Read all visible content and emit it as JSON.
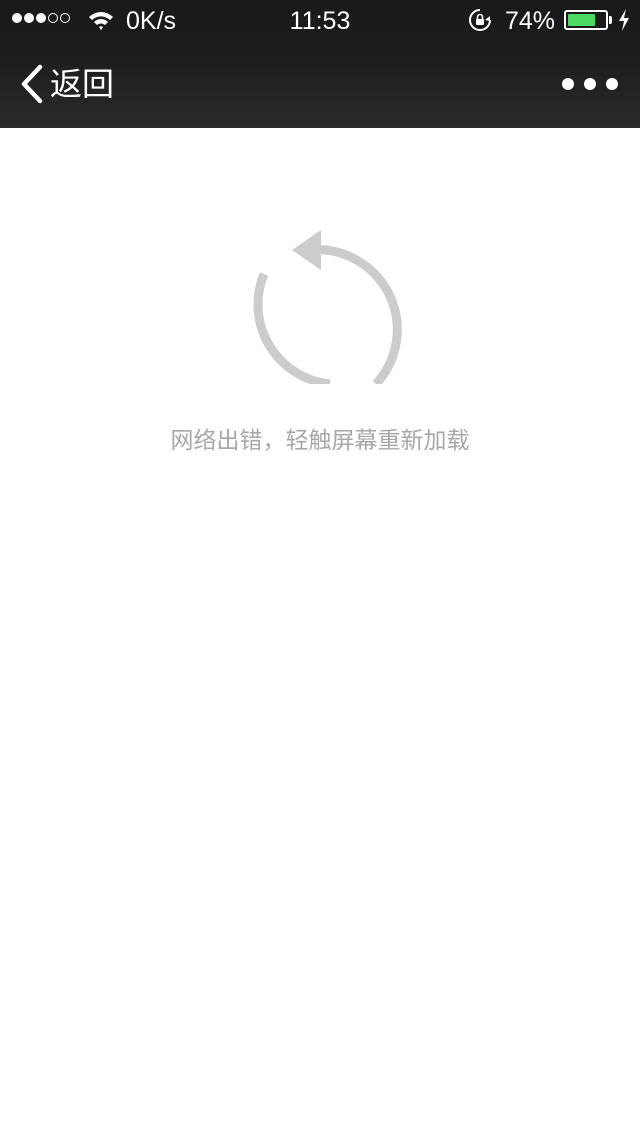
{
  "status_bar": {
    "signal_filled": 3,
    "signal_total": 5,
    "network_speed": "0K/s",
    "time": "11:53",
    "battery_percent_text": "74%",
    "battery_level": 0.74,
    "battery_color": "#4cd964",
    "icons": [
      "signal-icon",
      "wifi-icon",
      "rotation-lock-icon",
      "battery-icon",
      "charging-icon"
    ]
  },
  "nav": {
    "back_label": "返回",
    "back_icon": "chevron-left-icon",
    "more_icon": "more-dots-icon"
  },
  "main": {
    "reload_icon": "reload-icon",
    "icon_color": "#cccccc",
    "error_message": "网络出错，轻触屏幕重新加载"
  }
}
